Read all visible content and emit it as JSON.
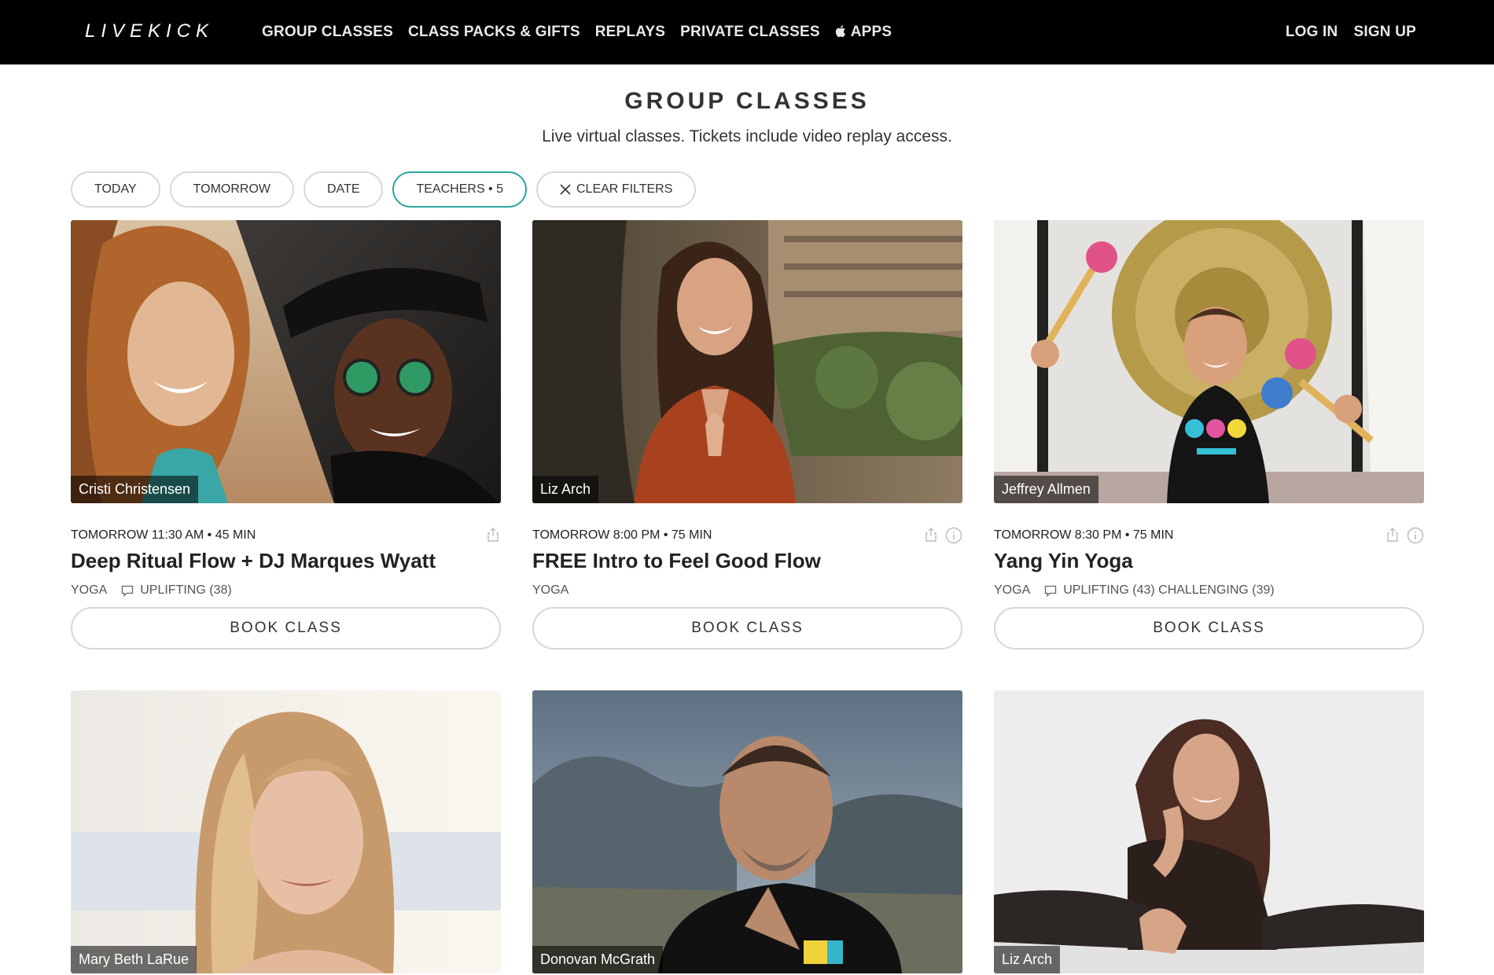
{
  "brand": {
    "logo": "LIVEKICK"
  },
  "nav": {
    "links": [
      "GROUP CLASSES",
      "CLASS PACKS & GIFTS",
      "REPLAYS",
      "PRIVATE CLASSES",
      "APPS"
    ],
    "login": "LOG IN",
    "signup": "SIGN UP"
  },
  "header": {
    "title": "GROUP CLASSES",
    "subtitle": "Live virtual classes. Tickets include video replay access."
  },
  "filters": {
    "today": "TODAY",
    "tomorrow": "TOMORROW",
    "date": "DATE",
    "teachers": "TEACHERS • 5",
    "clear": "CLEAR FILTERS"
  },
  "colors": {
    "accent": "#2aa6a0",
    "nav_bg": "#000000"
  },
  "cards": [
    {
      "teacher": "Cristi Christensen",
      "meta": "TOMORROW 11:30 AM • 45 MIN",
      "title": "Deep Ritual Flow + DJ Marques Wyatt",
      "category": "YOGA",
      "tags": "UPLIFTING (38)",
      "button": "BOOK CLASS"
    },
    {
      "teacher": "Liz Arch",
      "meta": "TOMORROW 8:00 PM • 75 MIN",
      "title": "FREE Intro to Feel Good Flow",
      "category": "YOGA",
      "tags": "",
      "button": "BOOK CLASS"
    },
    {
      "teacher": "Jeffrey Allmen",
      "meta": "TOMORROW 8:30 PM • 75 MIN",
      "title": "Yang Yin Yoga",
      "category": "YOGA",
      "tags": "UPLIFTING (43) CHALLENGING (39)",
      "button": "BOOK CLASS"
    },
    {
      "teacher": "Mary Beth LaRue"
    },
    {
      "teacher": "Donovan McGrath"
    },
    {
      "teacher": "Liz Arch"
    }
  ]
}
